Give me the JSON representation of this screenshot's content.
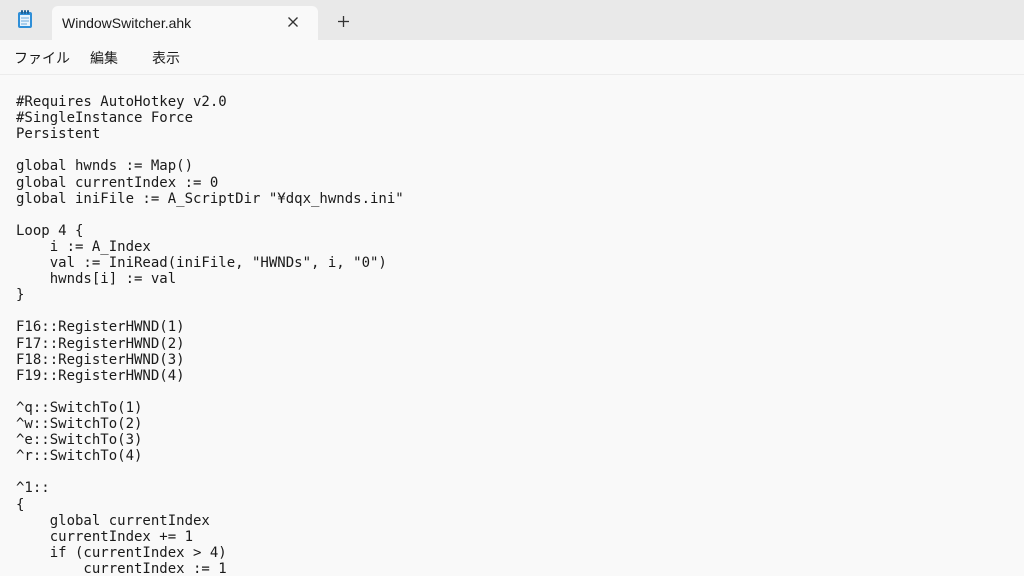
{
  "tab": {
    "title": "WindowSwitcher.ahk"
  },
  "menu": {
    "file": "ファイル",
    "edit": "編集",
    "view": "表示"
  },
  "icons": {
    "app": "notepad-icon",
    "close": "close-icon",
    "new_tab": "plus-icon"
  },
  "colors": {
    "titlebar": "#e9e9e9",
    "editor_bg": "#f9f9f9",
    "text": "#1a1a1a"
  },
  "code": [
    "#Requires AutoHotkey v2.0",
    "#SingleInstance Force",
    "Persistent",
    "",
    "global hwnds := Map()",
    "global currentIndex := 0",
    "global iniFile := A_ScriptDir \"¥dqx_hwnds.ini\"",
    "",
    "Loop 4 {",
    "    i := A_Index",
    "    val := IniRead(iniFile, \"HWNDs\", i, \"0\")",
    "    hwnds[i] := val",
    "}",
    "",
    "F16::RegisterHWND(1)",
    "F17::RegisterHWND(2)",
    "F18::RegisterHWND(3)",
    "F19::RegisterHWND(4)",
    "",
    "^q::SwitchTo(1)",
    "^w::SwitchTo(2)",
    "^e::SwitchTo(3)",
    "^r::SwitchTo(4)",
    "",
    "^1::",
    "{",
    "    global currentIndex",
    "    currentIndex += 1",
    "    if (currentIndex > 4)",
    "        currentIndex := 1"
  ]
}
